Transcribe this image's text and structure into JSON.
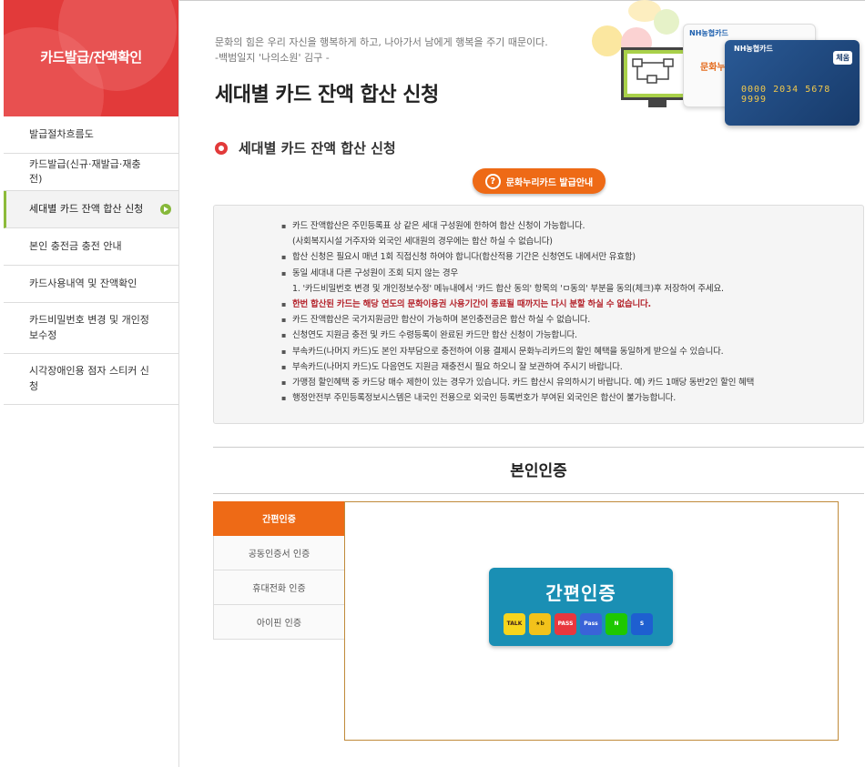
{
  "sidebar": {
    "title": "카드발급/잔액확인",
    "items": [
      {
        "label": "발급절차흐름도"
      },
      {
        "label": "카드발급(신규·재발급·재충전)"
      },
      {
        "label": "세대별 카드 잔액 합산 신청"
      },
      {
        "label": "본인 충전금 충전 안내"
      },
      {
        "label": "카드사용내역 및 잔액확인"
      },
      {
        "label": "카드비밀번호 변경 및 개인정보수정"
      },
      {
        "label": "시각장애인용 점자 스티커 신청"
      }
    ]
  },
  "header": {
    "quote_line1": "문화의 힘은 우리 자신을 행복하게 하고, 나아가서 남에게 행복을 주기 때문이다.",
    "quote_line2": "-백범일지 '나의소원' 김구 -",
    "page_title": "세대별 카드 잔액 합산 신청"
  },
  "deco": {
    "white_card_brand": "NH농협카드",
    "white_card_text": "문화누리",
    "blue_card_brand": "NH농협카드",
    "card_number": "0000 2034 5678 9999",
    "card_badge": "체움"
  },
  "section": {
    "title": "세대별 카드 잔액 합산 신청",
    "guide_button": "문화누리카드 발급안내"
  },
  "notices": [
    {
      "text": "카드 잔액합산은 주민등록표 상 같은 세대 구성원에 한하여 합산 신청이 가능합니다.",
      "type": "normal"
    },
    {
      "text": "(사회복지시설 거주자와 외국인 세대원의 경우에는 합산 하실 수 없습니다)",
      "type": "sub"
    },
    {
      "text": "합산 신청은 필요시 매년 1회 직접신청 하여야 합니다(합산적용 기간은 신청연도 내에서만 유효함)",
      "type": "normal"
    },
    {
      "text": "동일 세대내 다른 구성원이 조회 되지 않는 경우",
      "type": "normal"
    },
    {
      "text": "1. '카드비밀번호 변경 및 개인정보수정' 메뉴내에서 '카드 합산 동의' 항목의 'ㅁ동의' 부분을 동의(체크)후 저장하여 주세요.",
      "type": "sub"
    },
    {
      "text": "한번 합산된 카드는 해당 연도의 문화이용권 사용기간이 종료될 때까지는 다시 분할 하실 수 없습니다.",
      "type": "red"
    },
    {
      "text": "카드 잔액합산은 국가지원금만 합산이 가능하며 본인충전금은 합산 하실 수 없습니다.",
      "type": "normal"
    },
    {
      "text": "신청연도 지원금 충전 및 카드 수령등록이 완료된 카드만 합산 신청이 가능합니다.",
      "type": "normal"
    },
    {
      "text": "부속카드(나머지 카드)도 본인 자부담으로 충전하여 이용 결제시 문화누리카드의 할인 혜택을 동일하게 받으실 수 있습니다.",
      "type": "normal"
    },
    {
      "text": "부속카드(나머지 카드)도 다음연도 지원금 재충전시 필요 하오니 잘 보관하여 주시기 바랍니다.",
      "type": "normal"
    },
    {
      "text": "가맹점 할인혜택 중 카드당 매수 제한이 있는 경우가 있습니다. 카드 합산시 유의하시기 바랍니다. 예) 카드 1매당 동반2인 할인 혜택",
      "type": "normal"
    },
    {
      "text": "행정안전부 주민등록정보시스템은 내국인 전용으로 외국인 등록번호가 부여된 외국인은 합산이 불가능합니다.",
      "type": "normal"
    }
  ],
  "auth": {
    "title": "본인인증",
    "tabs": [
      {
        "label": "간편인증"
      },
      {
        "label": "공동인증서 인증"
      },
      {
        "label": "휴대전화 인증"
      },
      {
        "label": "아이핀 인증"
      }
    ],
    "simple_button": {
      "title": "간편인증",
      "providers": [
        {
          "name": "kakao-icon",
          "label": "TALK",
          "bg": "#f7d51d",
          "fg": "#3b1e1e"
        },
        {
          "name": "kb-icon",
          "label": "★b",
          "bg": "#f2c21b",
          "fg": "#4a3a00"
        },
        {
          "name": "pass-red-icon",
          "label": "PASS",
          "bg": "#e8373e",
          "fg": "#ffffff"
        },
        {
          "name": "pass-blue-icon",
          "label": "Pass",
          "bg": "#3a63d8",
          "fg": "#ffffff"
        },
        {
          "name": "naver-icon",
          "label": "N",
          "bg": "#1ec800",
          "fg": "#ffffff"
        },
        {
          "name": "shinhan-icon",
          "label": "S",
          "bg": "#1e5fd0",
          "fg": "#ffffff"
        }
      ]
    }
  }
}
